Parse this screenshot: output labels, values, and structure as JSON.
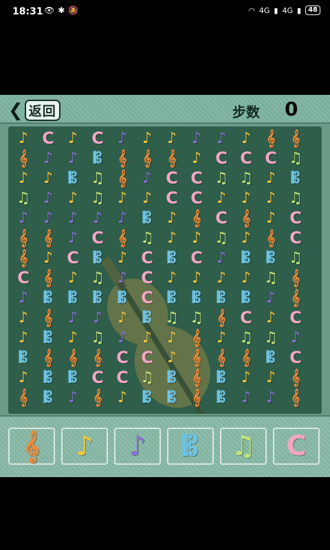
{
  "status_bar": {
    "time": "18:31",
    "battery": "48",
    "signal_text": "4G"
  },
  "header": {
    "back_label": "返回",
    "steps_label": "步数",
    "steps_value": "0"
  },
  "pieces": {
    "orange": {
      "glyph": "𝄞",
      "color": "#ee8a3a",
      "icon": "treble-clef-icon"
    },
    "yellow": {
      "glyph": "♪",
      "color": "#f4c63e",
      "icon": "eighth-note-icon"
    },
    "purple": {
      "glyph": "♪",
      "color": "#8c6fd6",
      "icon": "purple-eighth-note-icon"
    },
    "blue": {
      "glyph": "𝄡",
      "color": "#6ec3e3",
      "icon": "c-clef-icon"
    },
    "green": {
      "glyph": "♫",
      "color": "#c3e57a",
      "icon": "beamed-notes-icon"
    },
    "pink": {
      "glyph": "C",
      "color": "#f2a6c4",
      "icon": "letter-c-icon"
    }
  },
  "board": {
    "rows": [
      [
        "yellow",
        "pink",
        "yellow",
        "pink",
        "purple",
        "yellow",
        "yellow",
        "purple",
        "purple",
        "yellow",
        "orange",
        "orange"
      ],
      [
        "orange",
        "purple",
        "purple",
        "blue",
        "orange",
        "orange",
        "orange",
        "yellow",
        "pink",
        "pink",
        "pink",
        "green"
      ],
      [
        "yellow",
        "yellow",
        "blue",
        "green",
        "orange",
        "purple",
        "pink",
        "pink",
        "green",
        "green",
        "yellow",
        "blue"
      ],
      [
        "green",
        "purple",
        "yellow",
        "green",
        "yellow",
        "yellow",
        "pink",
        "pink",
        "yellow",
        "yellow",
        "yellow",
        "green"
      ],
      [
        "purple",
        "purple",
        "purple",
        "purple",
        "purple",
        "blue",
        "yellow",
        "orange",
        "pink",
        "orange",
        "yellow",
        "pink"
      ],
      [
        "orange",
        "orange",
        "purple",
        "pink",
        "orange",
        "green",
        "yellow",
        "yellow",
        "green",
        "yellow",
        "orange",
        "pink"
      ],
      [
        "orange",
        "yellow",
        "pink",
        "blue",
        "yellow",
        "pink",
        "blue",
        "pink",
        "purple",
        "blue",
        "blue",
        "green"
      ],
      [
        "pink",
        "orange",
        "yellow",
        "green",
        "purple",
        "pink",
        "yellow",
        "yellow",
        "yellow",
        "yellow",
        "green",
        "orange"
      ],
      [
        "purple",
        "blue",
        "blue",
        "blue",
        "blue",
        "pink",
        "blue",
        "blue",
        "blue",
        "blue",
        "purple",
        "orange"
      ],
      [
        "yellow",
        "orange",
        "purple",
        "purple",
        "yellow",
        "blue",
        "green",
        "green",
        "orange",
        "pink",
        "yellow",
        "pink"
      ],
      [
        "yellow",
        "blue",
        "yellow",
        "green",
        "purple",
        "yellow",
        "yellow",
        "orange",
        "yellow",
        "green",
        "green",
        "purple"
      ],
      [
        "blue",
        "orange",
        "orange",
        "orange",
        "pink",
        "pink",
        "yellow",
        "orange",
        "orange",
        "orange",
        "blue",
        "pink"
      ],
      [
        "yellow",
        "blue",
        "blue",
        "pink",
        "pink",
        "green",
        "blue",
        "orange",
        "blue",
        "yellow",
        "yellow",
        "orange"
      ],
      [
        "orange",
        "blue",
        "purple",
        "orange",
        "yellow",
        "blue",
        "blue",
        "orange",
        "blue",
        "purple",
        "purple",
        "orange"
      ]
    ]
  },
  "tray": {
    "slots": [
      "orange",
      "yellow",
      "purple",
      "blue",
      "green",
      "pink"
    ]
  }
}
